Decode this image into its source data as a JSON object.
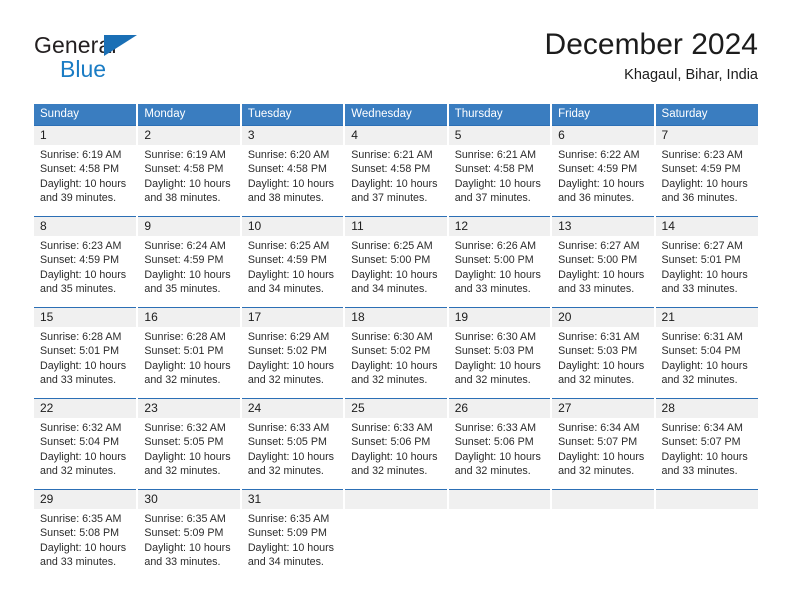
{
  "brand": {
    "name_top": "General",
    "name_bottom": "Blue",
    "accent_color": "#1a7cc4",
    "triangle_color": "#1a6fb5"
  },
  "header": {
    "title": "December 2024",
    "subtitle": "Khagaul, Bihar, India"
  },
  "theme": {
    "header_row_bg": "#3a7dc0",
    "daynum_bg": "#f0f0f0",
    "row_border": "#2c6fb5"
  },
  "weekday_headers": [
    "Sunday",
    "Monday",
    "Tuesday",
    "Wednesday",
    "Thursday",
    "Friday",
    "Saturday"
  ],
  "weeks": [
    [
      {
        "day": "1",
        "sunrise": "Sunrise: 6:19 AM",
        "sunset": "Sunset: 4:58 PM",
        "daylight_1": "Daylight: 10 hours",
        "daylight_2": "and 39 minutes."
      },
      {
        "day": "2",
        "sunrise": "Sunrise: 6:19 AM",
        "sunset": "Sunset: 4:58 PM",
        "daylight_1": "Daylight: 10 hours",
        "daylight_2": "and 38 minutes."
      },
      {
        "day": "3",
        "sunrise": "Sunrise: 6:20 AM",
        "sunset": "Sunset: 4:58 PM",
        "daylight_1": "Daylight: 10 hours",
        "daylight_2": "and 38 minutes."
      },
      {
        "day": "4",
        "sunrise": "Sunrise: 6:21 AM",
        "sunset": "Sunset: 4:58 PM",
        "daylight_1": "Daylight: 10 hours",
        "daylight_2": "and 37 minutes."
      },
      {
        "day": "5",
        "sunrise": "Sunrise: 6:21 AM",
        "sunset": "Sunset: 4:58 PM",
        "daylight_1": "Daylight: 10 hours",
        "daylight_2": "and 37 minutes."
      },
      {
        "day": "6",
        "sunrise": "Sunrise: 6:22 AM",
        "sunset": "Sunset: 4:59 PM",
        "daylight_1": "Daylight: 10 hours",
        "daylight_2": "and 36 minutes."
      },
      {
        "day": "7",
        "sunrise": "Sunrise: 6:23 AM",
        "sunset": "Sunset: 4:59 PM",
        "daylight_1": "Daylight: 10 hours",
        "daylight_2": "and 36 minutes."
      }
    ],
    [
      {
        "day": "8",
        "sunrise": "Sunrise: 6:23 AM",
        "sunset": "Sunset: 4:59 PM",
        "daylight_1": "Daylight: 10 hours",
        "daylight_2": "and 35 minutes."
      },
      {
        "day": "9",
        "sunrise": "Sunrise: 6:24 AM",
        "sunset": "Sunset: 4:59 PM",
        "daylight_1": "Daylight: 10 hours",
        "daylight_2": "and 35 minutes."
      },
      {
        "day": "10",
        "sunrise": "Sunrise: 6:25 AM",
        "sunset": "Sunset: 4:59 PM",
        "daylight_1": "Daylight: 10 hours",
        "daylight_2": "and 34 minutes."
      },
      {
        "day": "11",
        "sunrise": "Sunrise: 6:25 AM",
        "sunset": "Sunset: 5:00 PM",
        "daylight_1": "Daylight: 10 hours",
        "daylight_2": "and 34 minutes."
      },
      {
        "day": "12",
        "sunrise": "Sunrise: 6:26 AM",
        "sunset": "Sunset: 5:00 PM",
        "daylight_1": "Daylight: 10 hours",
        "daylight_2": "and 33 minutes."
      },
      {
        "day": "13",
        "sunrise": "Sunrise: 6:27 AM",
        "sunset": "Sunset: 5:00 PM",
        "daylight_1": "Daylight: 10 hours",
        "daylight_2": "and 33 minutes."
      },
      {
        "day": "14",
        "sunrise": "Sunrise: 6:27 AM",
        "sunset": "Sunset: 5:01 PM",
        "daylight_1": "Daylight: 10 hours",
        "daylight_2": "and 33 minutes."
      }
    ],
    [
      {
        "day": "15",
        "sunrise": "Sunrise: 6:28 AM",
        "sunset": "Sunset: 5:01 PM",
        "daylight_1": "Daylight: 10 hours",
        "daylight_2": "and 33 minutes."
      },
      {
        "day": "16",
        "sunrise": "Sunrise: 6:28 AM",
        "sunset": "Sunset: 5:01 PM",
        "daylight_1": "Daylight: 10 hours",
        "daylight_2": "and 32 minutes."
      },
      {
        "day": "17",
        "sunrise": "Sunrise: 6:29 AM",
        "sunset": "Sunset: 5:02 PM",
        "daylight_1": "Daylight: 10 hours",
        "daylight_2": "and 32 minutes."
      },
      {
        "day": "18",
        "sunrise": "Sunrise: 6:30 AM",
        "sunset": "Sunset: 5:02 PM",
        "daylight_1": "Daylight: 10 hours",
        "daylight_2": "and 32 minutes."
      },
      {
        "day": "19",
        "sunrise": "Sunrise: 6:30 AM",
        "sunset": "Sunset: 5:03 PM",
        "daylight_1": "Daylight: 10 hours",
        "daylight_2": "and 32 minutes."
      },
      {
        "day": "20",
        "sunrise": "Sunrise: 6:31 AM",
        "sunset": "Sunset: 5:03 PM",
        "daylight_1": "Daylight: 10 hours",
        "daylight_2": "and 32 minutes."
      },
      {
        "day": "21",
        "sunrise": "Sunrise: 6:31 AM",
        "sunset": "Sunset: 5:04 PM",
        "daylight_1": "Daylight: 10 hours",
        "daylight_2": "and 32 minutes."
      }
    ],
    [
      {
        "day": "22",
        "sunrise": "Sunrise: 6:32 AM",
        "sunset": "Sunset: 5:04 PM",
        "daylight_1": "Daylight: 10 hours",
        "daylight_2": "and 32 minutes."
      },
      {
        "day": "23",
        "sunrise": "Sunrise: 6:32 AM",
        "sunset": "Sunset: 5:05 PM",
        "daylight_1": "Daylight: 10 hours",
        "daylight_2": "and 32 minutes."
      },
      {
        "day": "24",
        "sunrise": "Sunrise: 6:33 AM",
        "sunset": "Sunset: 5:05 PM",
        "daylight_1": "Daylight: 10 hours",
        "daylight_2": "and 32 minutes."
      },
      {
        "day": "25",
        "sunrise": "Sunrise: 6:33 AM",
        "sunset": "Sunset: 5:06 PM",
        "daylight_1": "Daylight: 10 hours",
        "daylight_2": "and 32 minutes."
      },
      {
        "day": "26",
        "sunrise": "Sunrise: 6:33 AM",
        "sunset": "Sunset: 5:06 PM",
        "daylight_1": "Daylight: 10 hours",
        "daylight_2": "and 32 minutes."
      },
      {
        "day": "27",
        "sunrise": "Sunrise: 6:34 AM",
        "sunset": "Sunset: 5:07 PM",
        "daylight_1": "Daylight: 10 hours",
        "daylight_2": "and 32 minutes."
      },
      {
        "day": "28",
        "sunrise": "Sunrise: 6:34 AM",
        "sunset": "Sunset: 5:07 PM",
        "daylight_1": "Daylight: 10 hours",
        "daylight_2": "and 33 minutes."
      }
    ],
    [
      {
        "day": "29",
        "sunrise": "Sunrise: 6:35 AM",
        "sunset": "Sunset: 5:08 PM",
        "daylight_1": "Daylight: 10 hours",
        "daylight_2": "and 33 minutes."
      },
      {
        "day": "30",
        "sunrise": "Sunrise: 6:35 AM",
        "sunset": "Sunset: 5:09 PM",
        "daylight_1": "Daylight: 10 hours",
        "daylight_2": "and 33 minutes."
      },
      {
        "day": "31",
        "sunrise": "Sunrise: 6:35 AM",
        "sunset": "Sunset: 5:09 PM",
        "daylight_1": "Daylight: 10 hours",
        "daylight_2": "and 34 minutes."
      },
      {
        "day": "",
        "sunrise": "",
        "sunset": "",
        "daylight_1": "",
        "daylight_2": "",
        "empty": true
      },
      {
        "day": "",
        "sunrise": "",
        "sunset": "",
        "daylight_1": "",
        "daylight_2": "",
        "empty": true
      },
      {
        "day": "",
        "sunrise": "",
        "sunset": "",
        "daylight_1": "",
        "daylight_2": "",
        "empty": true
      },
      {
        "day": "",
        "sunrise": "",
        "sunset": "",
        "daylight_1": "",
        "daylight_2": "",
        "empty": true
      }
    ]
  ]
}
